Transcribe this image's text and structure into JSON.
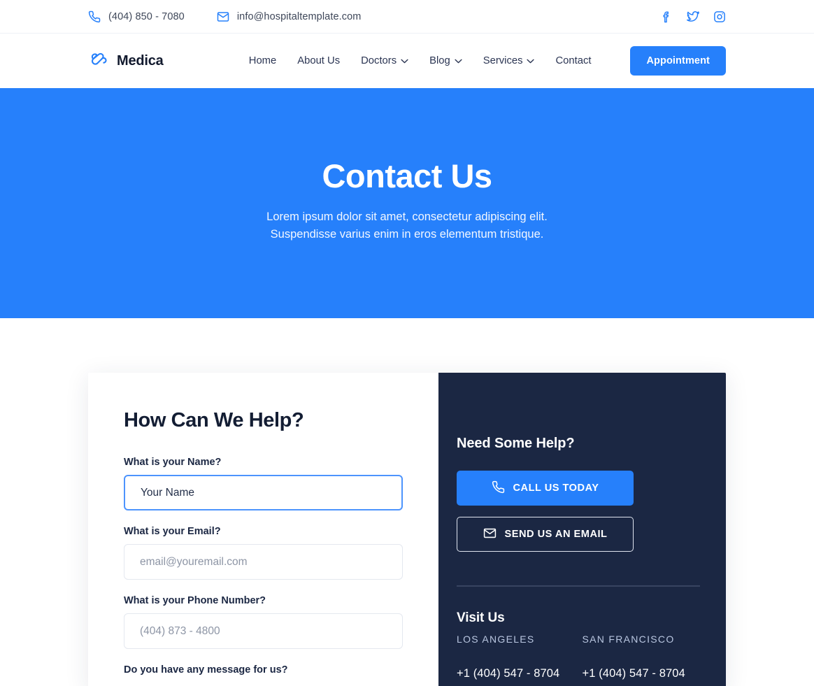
{
  "colors": {
    "accent_blue": "#2680fb",
    "dark_navy": "#1b2743",
    "text_dark": "#1b2743",
    "placeholder_gray": "#8d95a5",
    "light_blue_gray": "#b9c6e0"
  },
  "topbar": {
    "phone": "(404) 850 - 7080",
    "email": "info@hospitaltemplate.com",
    "socials": [
      "facebook-icon",
      "twitter-icon",
      "instagram-icon"
    ]
  },
  "nav": {
    "brand": "Medica",
    "logo_icon": "medical-cross-logo-icon",
    "items": [
      {
        "label": "Home",
        "has_dropdown": false
      },
      {
        "label": "About Us",
        "has_dropdown": false
      },
      {
        "label": "Doctors",
        "has_dropdown": true
      },
      {
        "label": "Blog",
        "has_dropdown": true
      },
      {
        "label": "Services",
        "has_dropdown": true
      },
      {
        "label": "Contact",
        "has_dropdown": false
      }
    ],
    "appointment_label": "Appointment"
  },
  "hero": {
    "title": "Contact Us",
    "subtitle_line1": "Lorem ipsum dolor sit amet, consectetur adipiscing elit.",
    "subtitle_line2": "Suspendisse varius enim in eros elementum tristique."
  },
  "form": {
    "title": "How Can We Help?",
    "fields": [
      {
        "label": "What is your Name?",
        "placeholder": "Your Name",
        "value": "",
        "focused": true
      },
      {
        "label": "What is your Email?",
        "placeholder": "email@youremail.com",
        "value": "",
        "focused": false
      },
      {
        "label": "What is your Phone Number?",
        "placeholder": "(404) 873 - 4800",
        "value": "",
        "focused": false
      },
      {
        "label": "Do you have any message for us?",
        "placeholder": "",
        "value": "",
        "focused": false
      }
    ]
  },
  "help_panel": {
    "title": "Need Some Help?",
    "call_button": {
      "label": "CALL US TODAY",
      "icon": "phone-icon"
    },
    "email_button": {
      "label": "SEND US AN EMAIL",
      "icon": "envelope-icon"
    },
    "visit_title": "Visit Us",
    "locations": [
      {
        "city": "LOS ANGELES",
        "phone": "+1 (404) 547 - 8704"
      },
      {
        "city": "SAN FRANCISCO",
        "phone": "+1 (404) 547 - 8704"
      }
    ]
  }
}
